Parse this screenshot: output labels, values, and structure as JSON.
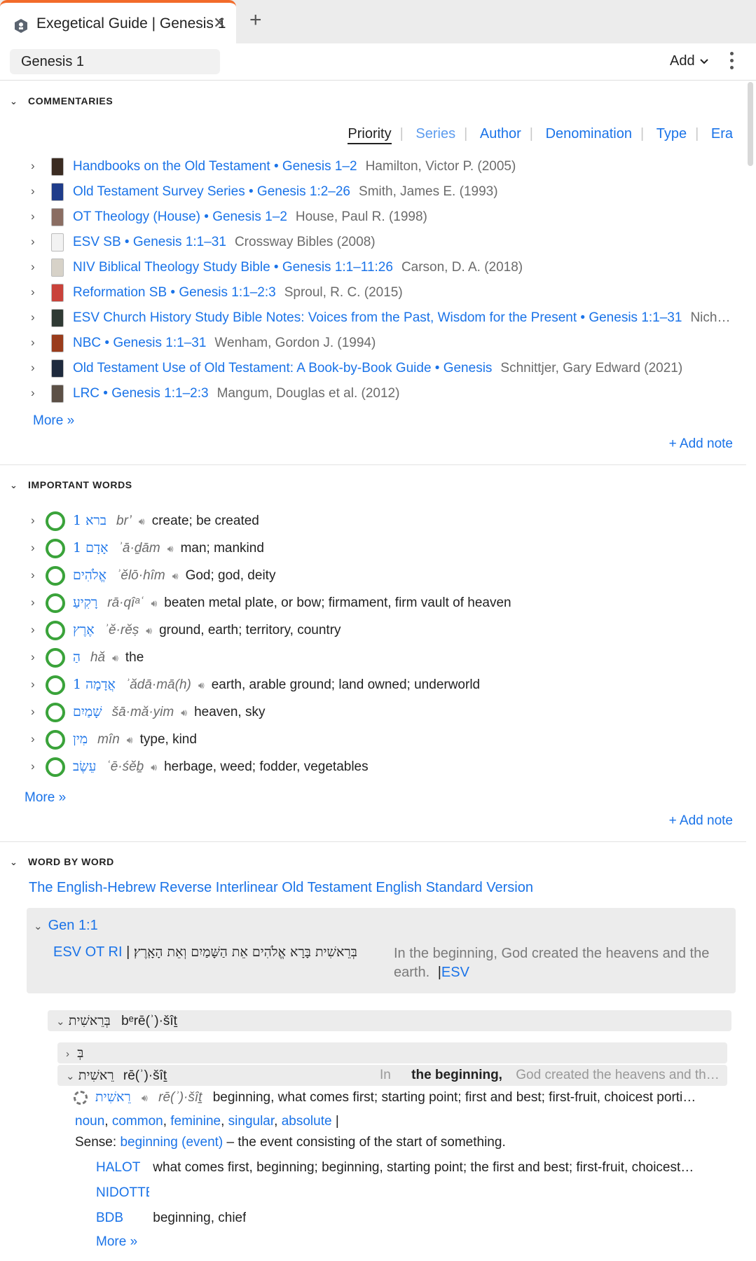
{
  "tab": {
    "title": "Exegetical Guide | Genesis 1",
    "close": "✕",
    "add": "+"
  },
  "toolbar": {
    "reference": "Genesis 1",
    "add_label": "Add"
  },
  "commentaries": {
    "heading": "COMMENTARIES",
    "sort_options": [
      "Priority",
      "Series",
      "Author",
      "Denomination",
      "Type",
      "Era"
    ],
    "items": [
      {
        "title": "Handbooks on the Old Testament • Genesis 1–2",
        "author": "Hamilton, Victor P. (2005)",
        "cover": "#3b2c22"
      },
      {
        "title": "Old Testament Survey Series • Genesis 1:2–26",
        "author": "Smith, James E. (1993)",
        "cover": "#1f3c8a"
      },
      {
        "title": "OT Theology (House) • Genesis 1–2",
        "author": "House, Paul R. (1998)",
        "cover": "#8a6d62"
      },
      {
        "title": "ESV SB • Genesis 1:1–31",
        "author": "Crossway Bibles (2008)",
        "cover": "#f2f2f2"
      },
      {
        "title": "NIV Biblical Theology Study Bible • Genesis 1:1–11:26",
        "author": "Carson, D. A. (2018)",
        "cover": "#d7d2c8"
      },
      {
        "title": "Reformation SB • Genesis 1:1–2:3",
        "author": "Sproul, R. C. (2015)",
        "cover": "#c9423a"
      },
      {
        "title": "ESV Church History Study Bible Notes: Voices from the Past, Wisdom for the Present • Genesis 1:1–31",
        "author": "Nich…",
        "cover": "#2f3a34"
      },
      {
        "title": "NBC • Genesis 1:1–31",
        "author": "Wenham, Gordon J. (1994)",
        "cover": "#9a3c1c"
      },
      {
        "title": "Old Testament Use of Old Testament: A Book-by-Book Guide • Genesis",
        "author": "Schnittjer, Gary Edward (2021)",
        "cover": "#1e2a3d"
      },
      {
        "title": "LRC • Genesis 1:1–2:3",
        "author": "Mangum, Douglas et al. (2012)",
        "cover": "#5c5046"
      }
    ],
    "more": "More »",
    "add_note": "+ Add note"
  },
  "important_words": {
    "heading": "IMPORTANT WORDS",
    "items": [
      {
        "lemma": "1 ברא",
        "translit": "br’",
        "gloss": "create; be created"
      },
      {
        "lemma": "1 אָדָם",
        "translit": "ʾā·ḏām",
        "gloss": "man; mankind"
      },
      {
        "lemma": "אֱלֹהִים",
        "translit": "ʾĕlō·hîm",
        "gloss": "God; god, deity"
      },
      {
        "lemma": "רָקִיעַ",
        "translit": "rā·qîᵃʿ",
        "gloss": "beaten metal plate, or bow; firmament, firm vault of heaven"
      },
      {
        "lemma": "אֶרֶץ",
        "translit": "ʾĕ·rĕṣ",
        "gloss": "ground, earth; territory, country"
      },
      {
        "lemma": "הַ",
        "translit": "hă",
        "gloss": "the"
      },
      {
        "lemma": "1 אֲדָמָה",
        "translit": "ʾădā·mā(h)",
        "gloss": "earth, arable ground; land owned; underworld"
      },
      {
        "lemma": "שָׁמַיִם",
        "translit": "šā·mă·yim",
        "gloss": "heaven, sky"
      },
      {
        "lemma": "מִין",
        "translit": "mîn",
        "gloss": "type, kind"
      },
      {
        "lemma": "עֵשֶׂב",
        "translit": "ʿē·śĕḇ",
        "gloss": "herbage, weed; fodder, vegetables"
      }
    ],
    "more": "More »",
    "add_note": "+ Add note"
  },
  "word_by_word": {
    "heading": "WORD BY WORD",
    "resource": "The English-Hebrew Reverse Interlinear Old Testament English Standard Version",
    "verse_ref": "Gen 1:1",
    "ri_label": "ESV OT RI",
    "hebrew_verse": "בְּרֵאשִׁית בָּרָא אֱלֹהִים אֵת הַשָּׁמַיִם וְאֵת הָאָֽרֶץ׃",
    "english_verse": "In the beginning, God created the heavens and the earth.",
    "esv_label": "ESV",
    "word_heb": "בְּרֵאשִׁית",
    "word_translit": "bᵉrē(ʾ)·šîṯ",
    "prefix_heb": "בְּ",
    "root_heb": "רֵאשִׁית",
    "root_translit": "rē(ʾ)·šîṯ",
    "context_in": "In",
    "context_bold": "the beginning,",
    "context_rest": "God created the heavens and th…",
    "lemma_heb": "רֵאשִׁית",
    "lemma_translit": "rē(ʾ)·šîṯ",
    "lemma_gloss": "beginning, what comes first; starting point; first and best; first-fruit, choicest porti…",
    "morph": [
      "noun",
      "common",
      "feminine",
      "singular",
      "absolute"
    ],
    "sense_label": "Sense:",
    "sense_link": "beginning (event)",
    "sense_def": "– the event consisting of the start of something.",
    "lexicons": [
      {
        "name": "HALOT",
        "def": "what comes first, beginning; beginning, starting point; the first and best; first-fruit, choicest…"
      },
      {
        "name": "NIDOTTE",
        "def": ""
      },
      {
        "name": "BDB",
        "def": "beginning, chief"
      }
    ],
    "more": "More »"
  }
}
